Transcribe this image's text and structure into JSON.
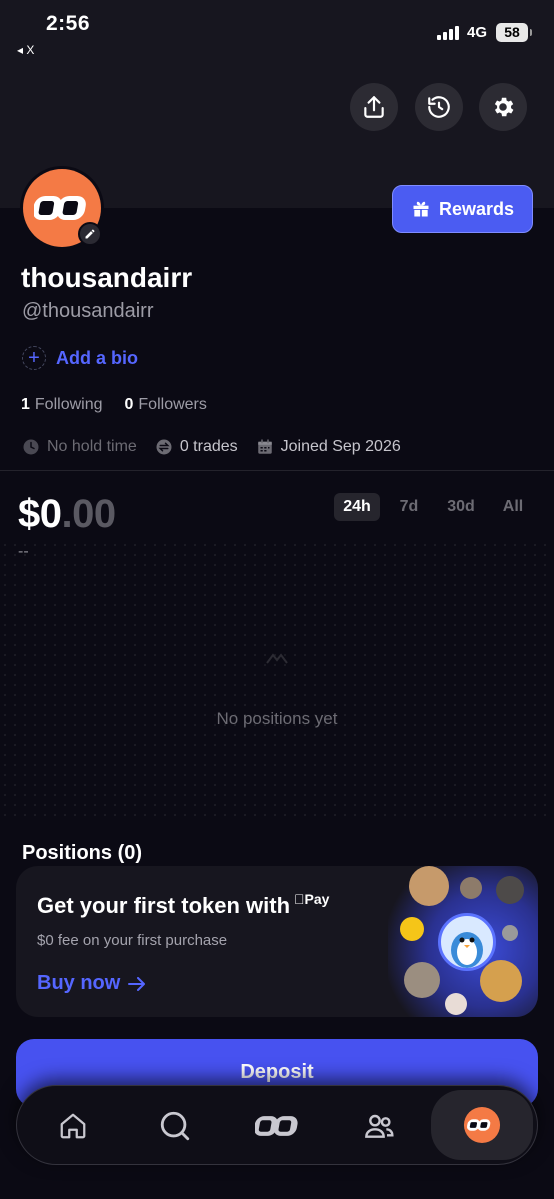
{
  "status_bar": {
    "time": "2:56",
    "back_label": "◂ X",
    "network": "4G",
    "battery": "58"
  },
  "header": {
    "actions": [
      "share-icon",
      "history-icon",
      "gear-icon"
    ],
    "rewards_label": "Rewards"
  },
  "profile": {
    "username": "thousandairr",
    "handle": "@thousandairr",
    "add_bio_label": "Add a bio",
    "following_count": "1",
    "following_label": "Following",
    "followers_count": "0",
    "followers_label": "Followers",
    "hold_time": "No hold time",
    "trades": "0 trades",
    "joined": "Joined Sep 2026"
  },
  "portfolio": {
    "balance_main": "$0",
    "balance_cents": ".00",
    "change": "--",
    "ranges": [
      "24h",
      "7d",
      "30d",
      "All"
    ],
    "active_range": "24h",
    "empty_message": "No positions yet"
  },
  "positions": {
    "title": "Positions (0)",
    "promo_title": "Get your first token with",
    "promo_pay": "Pay",
    "promo_subtitle": "$0 fee on your first purchase",
    "promo_link": "Buy now"
  },
  "deposit_label": "Deposit",
  "nav": [
    "home-icon",
    "search-icon",
    "logo-icon",
    "people-icon",
    "profile-avatar-icon"
  ],
  "colors": {
    "accent": "#4b5cf2",
    "avatar": "#f47a45",
    "background": "#0b0a14"
  }
}
